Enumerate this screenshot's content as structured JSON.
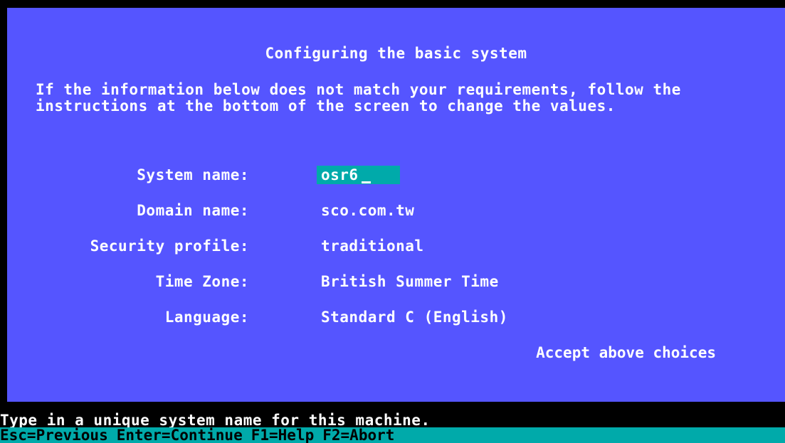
{
  "screen": {
    "title": "Configuring the basic system",
    "intro_line1": "If the information below does not match your requirements, follow the",
    "intro_line2": "instructions at the bottom of the screen to change the values."
  },
  "fields": {
    "system_name": {
      "label": "System name:",
      "value": "osr6"
    },
    "domain_name": {
      "label": "Domain name:",
      "value": "sco.com.tw"
    },
    "security_profile": {
      "label": "Security profile:",
      "value": "traditional"
    },
    "time_zone": {
      "label": "Time Zone:",
      "value": "British Summer Time"
    },
    "language": {
      "label": "Language:",
      "value": "Standard C (English)"
    }
  },
  "accept_label": "Accept above choices",
  "status_message": "Type in a unique system name for this machine.",
  "keys": {
    "esc": "Esc=Previous",
    "enter": "Enter=Continue",
    "f1": "F1=Help",
    "f2": "F2=Abort"
  },
  "colors": {
    "panel": "#5555ff",
    "input_highlight": "#00aaaa",
    "key_bar": "#00aaaa",
    "background": "#000000"
  }
}
